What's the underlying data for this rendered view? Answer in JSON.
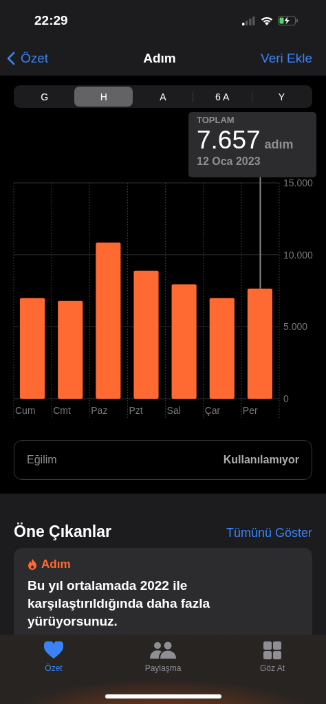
{
  "status_bar": {
    "time": "22:29"
  },
  "nav": {
    "back": "Özet",
    "title": "Adım",
    "action": "Veri Ekle"
  },
  "segments": [
    {
      "label": "G",
      "selected": false
    },
    {
      "label": "H",
      "selected": true
    },
    {
      "label": "A",
      "selected": false
    },
    {
      "label": "6 A",
      "selected": false
    },
    {
      "label": "Y",
      "selected": false
    }
  ],
  "tooltip": {
    "label": "TOPLAM",
    "value": "7.657",
    "unit": "adım",
    "date": "12 Oca 2023"
  },
  "chart_data": {
    "type": "bar",
    "categories": [
      "Cum",
      "Cmt",
      "Paz",
      "Pzt",
      "Sal",
      "Çar",
      "Per"
    ],
    "series": [
      {
        "color": "#ff6a33",
        "values": [
          7000,
          6800,
          10850,
          8900,
          7950,
          7000,
          7650
        ]
      }
    ],
    "ylim": [
      0,
      15000
    ],
    "yticks": [
      {
        "value": 0,
        "label": "0"
      },
      {
        "value": 5000,
        "label": "5.000"
      },
      {
        "value": 10000,
        "label": "10.000"
      },
      {
        "value": 15000,
        "label": "15.000"
      }
    ]
  },
  "trend": {
    "label": "Eğilim",
    "value": "Kullanılamıyor"
  },
  "highlights": {
    "title": "Öne Çıkanlar",
    "link": "Tümünü Göster",
    "card": {
      "category": "Adım",
      "text": "Bu yıl ortalamada 2022 ile karşılaştırıldığında daha fazla yürüyorsunuz."
    }
  },
  "tab_bar": [
    {
      "label": "Özet",
      "kind": "heart",
      "selected": true
    },
    {
      "label": "Paylaşma",
      "kind": "people",
      "selected": false
    },
    {
      "label": "Göz At",
      "kind": "grid",
      "selected": false
    }
  ]
}
